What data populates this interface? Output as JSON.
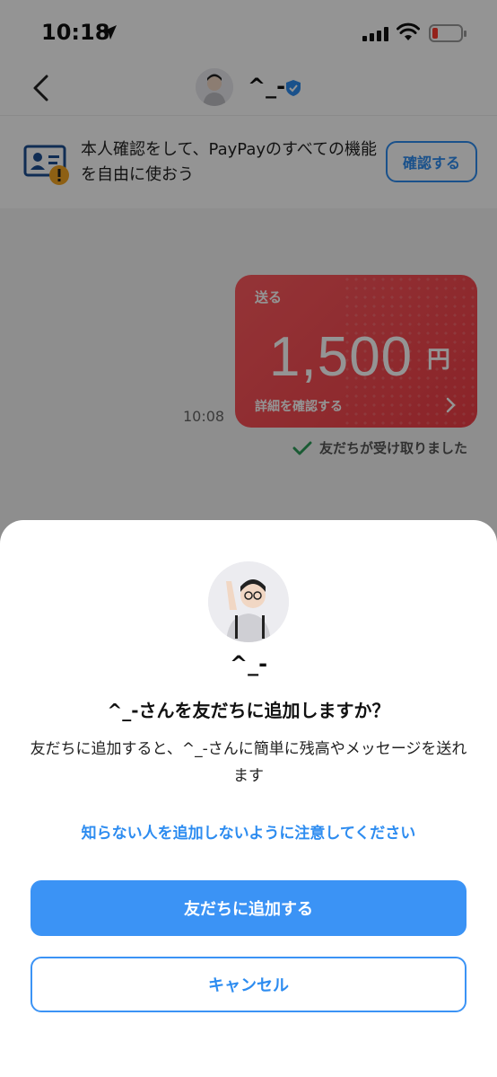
{
  "status_bar": {
    "time": "10:18",
    "location_icon": "location-arrow-icon",
    "signal_icon": "cellular-signal-icon",
    "wifi_icon": "wifi-icon",
    "battery_icon": "battery-low-icon",
    "battery_color": "#ff3b30"
  },
  "header": {
    "back_icon": "chevron-left-icon",
    "title": "^_-",
    "verified_icon": "verified-shield-icon"
  },
  "banner": {
    "icon": "id-card-warning-icon",
    "text": "本人確認をして、PayPayのすべての機能を自由に使おう",
    "button_label": "確認する"
  },
  "message": {
    "time": "10:08",
    "card_label": "送る",
    "amount": "1,500",
    "currency": "円",
    "detail_link": "詳細を確認する",
    "status": "友だちが受け取りました",
    "card_color": "#ef3e46",
    "check_color": "#2e9e5b"
  },
  "sheet": {
    "name": "^_-",
    "question": "^_-さんを友だちに追加しますか？",
    "description": "友だちに追加すると、^_-さんに簡単に残高やメッセージを送れます",
    "warning": "知らない人を追加しないように注意してください",
    "add_button": "友だちに追加する",
    "cancel_button": "キャンセル",
    "accent_color": "#3b93f5"
  }
}
